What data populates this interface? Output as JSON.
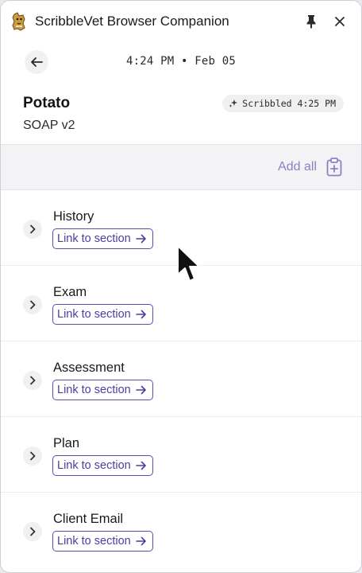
{
  "window": {
    "title": "ScribbleVet Browser Companion",
    "logo_icon": "dog-logo-icon",
    "pin_icon": "pin-icon",
    "close_icon": "close-icon"
  },
  "nav": {
    "time": "4:24 PM",
    "separator": "•",
    "date": "Feb 05",
    "back_icon": "arrow-left-icon"
  },
  "patient": {
    "name": "Potato",
    "template": "SOAP v2",
    "badge": {
      "icon": "sparkle-icon",
      "text": "Scribbled 4:25 PM"
    }
  },
  "toolbar": {
    "add_all_label": "Add all",
    "add_all_icon": "clipboard-plus-icon"
  },
  "sections": [
    {
      "title": "History",
      "link_label": "Link to section"
    },
    {
      "title": "Exam",
      "link_label": "Link to section"
    },
    {
      "title": "Assessment",
      "link_label": "Link to section"
    },
    {
      "title": "Plan",
      "link_label": "Link to section"
    },
    {
      "title": "Client Email",
      "link_label": "Link to section"
    }
  ],
  "colors": {
    "accent": "#5b4fb3",
    "accent_light": "#8a80c8",
    "panel_gray": "#f3f3f5"
  }
}
